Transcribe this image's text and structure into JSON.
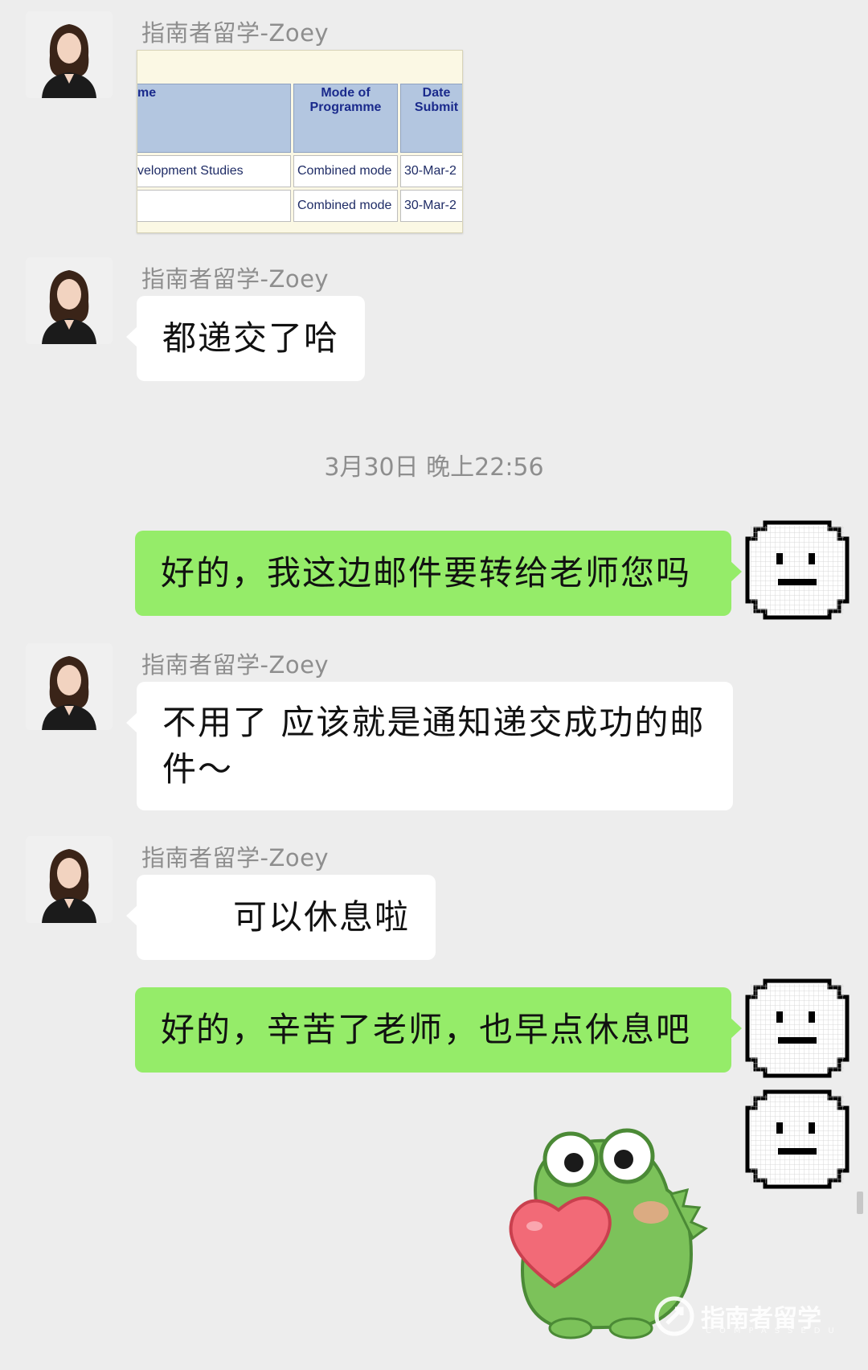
{
  "chat": {
    "sender_name": "指南者留学-Zoey",
    "timestamp": "3月30日 晚上22:56",
    "messages": [
      {
        "from": "other",
        "type": "image"
      },
      {
        "from": "other",
        "type": "text",
        "text": "都递交了哈"
      },
      {
        "from": "me",
        "type": "text",
        "text": "好的，我这边邮件要转给老师您吗"
      },
      {
        "from": "other",
        "type": "text",
        "text": "不用了 应该就是通知递交成功的邮件～"
      },
      {
        "from": "other",
        "type": "text",
        "text": "可以休息啦"
      },
      {
        "from": "me",
        "type": "text",
        "text": "好的，辛苦了老师，也早点休息吧"
      },
      {
        "from": "me",
        "type": "sticker",
        "sticker": "frog-holding-heart-sticker"
      }
    ]
  },
  "screenshot_table": {
    "headers": [
      "me",
      "Mode of Programme",
      "Date Submit"
    ],
    "rows": [
      [
        "velopment Studies",
        "Combined mode",
        "30-Mar-2"
      ],
      [
        "",
        "Combined mode",
        "30-Mar-2"
      ]
    ]
  },
  "watermark": {
    "brand": "指南者留学",
    "sub": "COMPASSEDU"
  },
  "colors": {
    "background": "#ededed",
    "my_bubble": "#95ec69",
    "their_bubble": "#ffffff",
    "table_header": "#b3c6e0"
  }
}
